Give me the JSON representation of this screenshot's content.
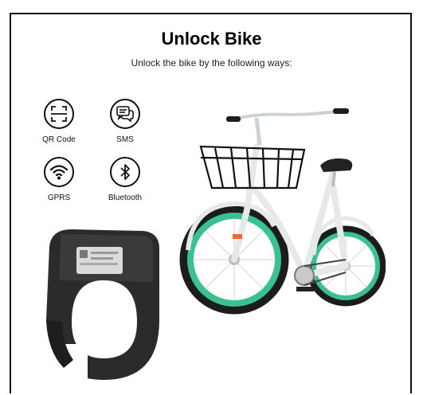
{
  "header": {
    "title": "Unlock Bike",
    "subtitle": "Unlock the bike by the following ways:"
  },
  "methods": [
    {
      "label": "QR Code",
      "icon": "qr-code-icon"
    },
    {
      "label": "SMS",
      "icon": "sms-icon"
    },
    {
      "label": "GPRS",
      "icon": "wifi-icon"
    },
    {
      "label": "Bluetooth",
      "icon": "bluetooth-icon"
    }
  ],
  "colors": {
    "tire": "#39c28e",
    "frame": "#e6e8ea",
    "lock_body": "#2a2a2c",
    "border": "#111111"
  }
}
